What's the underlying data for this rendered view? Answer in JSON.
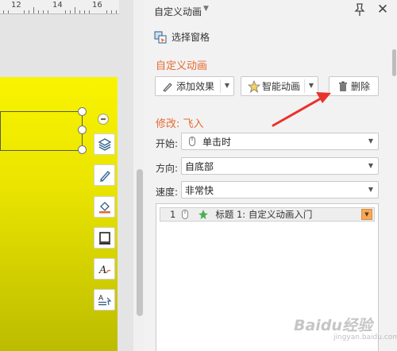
{
  "ruler": {
    "labels": [
      "12",
      "14",
      "16"
    ]
  },
  "panel": {
    "title": "自定义动画",
    "select_pane_label": "选择窗格",
    "section_title": "自定义动画",
    "buttons": {
      "add_effect": "添加效果",
      "smart_anim": "智能动画",
      "delete": "删除"
    },
    "modify_title": "修改: 飞入",
    "fields": {
      "start_label": "开始:",
      "start_value": "单击时",
      "direction_label": "方向:",
      "direction_value": "自底部",
      "speed_label": "速度:",
      "speed_value": "非常快"
    },
    "list": {
      "item_index": "1",
      "item_text": "标题 1: 自定义动画入门"
    }
  },
  "colors": {
    "accent_orange": "#e6692f",
    "slide_yellow": "#f9f400",
    "arrow_red": "#e8332c"
  },
  "icons": [
    "layers-icon",
    "pen-icon",
    "fill-bucket-icon",
    "frame-icon",
    "text-style-icon",
    "text-format-icon",
    "pin-icon",
    "close-icon",
    "mouse-icon",
    "star-icon",
    "trash-icon"
  ],
  "watermark": {
    "text": "Baidu经验",
    "sub": "jingyan.baidu.com"
  }
}
